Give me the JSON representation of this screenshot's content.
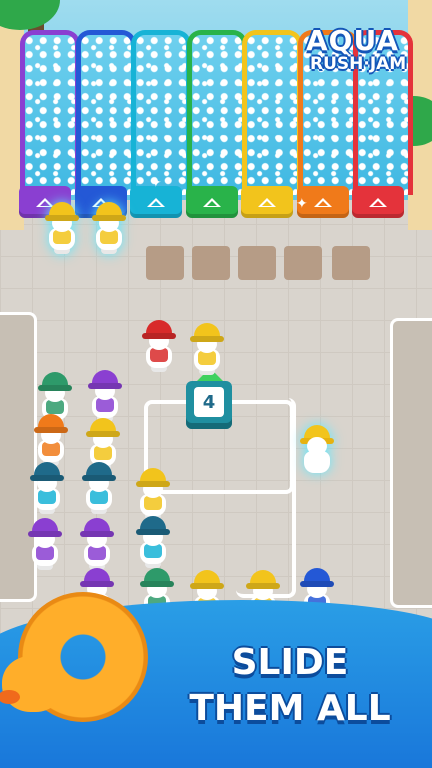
{
  "logo": {
    "line1": "AQUA",
    "line2": "RUSH·JAM"
  },
  "tagline": {
    "line1": "SLIDE",
    "line2": "THEM ALL"
  },
  "block": {
    "number": "4"
  },
  "lanes": [
    {
      "color": "#8a3fd1"
    },
    {
      "color": "#2458d6"
    },
    {
      "color": "#17b3d6"
    },
    {
      "color": "#29b34a"
    },
    {
      "color": "#f2c41c"
    },
    {
      "color": "#f07a1a"
    },
    {
      "color": "#e4333b"
    }
  ],
  "colors": {
    "sky_pool": "#62c6e6",
    "banner": "#1670d8",
    "ring": "#ffae2a"
  },
  "icons": [
    "slide-arrow-icon",
    "ring-float-icon",
    "duck-icon",
    "sparkle-icon"
  ]
}
